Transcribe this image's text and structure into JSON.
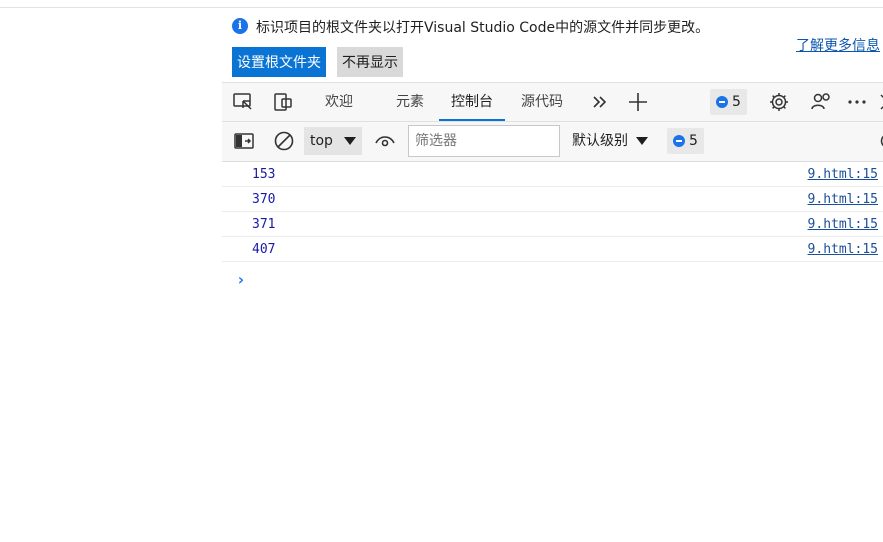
{
  "infobar": {
    "message": "标识项目的根文件夹以打开Visual Studio Code中的源文件并同步更改。",
    "learn_more": "了解更多信息",
    "set_root_button": "设置根文件夹",
    "dont_show_button": "不再显示"
  },
  "tabs": [
    {
      "label": "欢迎"
    },
    {
      "label": "元素"
    },
    {
      "label": "控制台",
      "active": true
    },
    {
      "label": "源代码"
    }
  ],
  "tabbar": {
    "issues_count": "5"
  },
  "console_toolbar": {
    "context": "top",
    "filter_placeholder": "筛选器",
    "levels": "默认级别",
    "issues_count": "5"
  },
  "messages": [
    {
      "value": "153",
      "source": "9.html:15"
    },
    {
      "value": "370",
      "source": "9.html:15"
    },
    {
      "value": "371",
      "source": "9.html:15"
    },
    {
      "value": "407",
      "source": "9.html:15"
    }
  ],
  "colors": {
    "accent": "#0a74d4",
    "info_icon": "#1a73e8",
    "number": "#1a1aa6"
  }
}
